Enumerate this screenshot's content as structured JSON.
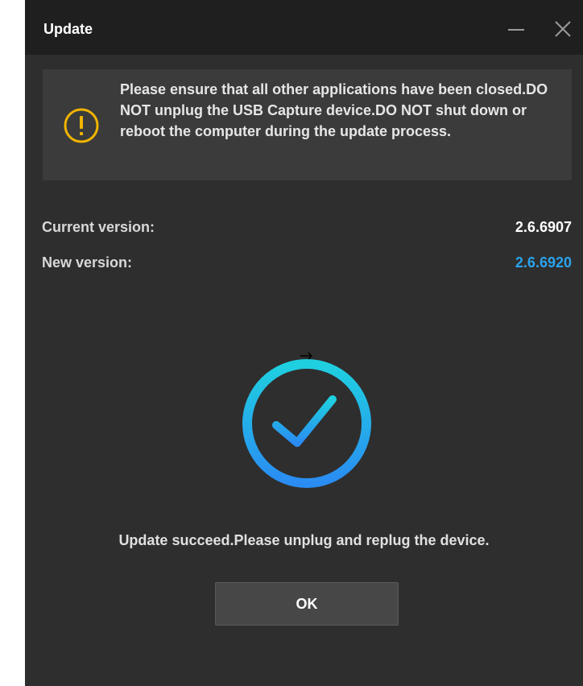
{
  "window": {
    "title": "Update"
  },
  "titlebar": {
    "minimize_icon": "minimize-icon",
    "close_icon": "close-icon"
  },
  "warning": {
    "icon": "warning-icon",
    "color": "#f0b400",
    "text": "Please ensure that all other applications have been closed.DO NOT unplug the USB Capture device.DO NOT shut down or reboot the computer during the update process."
  },
  "versions": {
    "current_label": "Current version:",
    "current_value": "2.6.6907",
    "new_label": "New version:",
    "new_value": "2.6.6920",
    "new_value_color": "#2aa3ec"
  },
  "status": {
    "icon": "success-check-icon",
    "progress": 1.0,
    "ring_colors": [
      "#1fd0e0",
      "#2a8cf2"
    ],
    "message": "Update succeed.Please unplug and replug the device."
  },
  "actions": {
    "ok_label": "OK"
  }
}
